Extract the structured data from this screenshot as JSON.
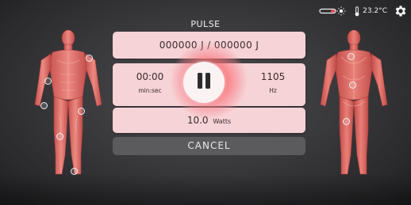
{
  "status_bar": {
    "laser_icon": "laser-probe-icon",
    "temperature": "23.2°C",
    "thermometer_icon": "thermometer-icon",
    "settings_icon": "gear-icon"
  },
  "mode_title": "PULSE",
  "energy": "000000 J / 000000 J",
  "timer": {
    "value": "00:00",
    "unit": "min:sec"
  },
  "frequency": {
    "value": "1105",
    "unit": "Hz"
  },
  "power": {
    "value": "10.0",
    "unit": "Watts"
  },
  "pause_icon": "pause-icon",
  "cancel_label": "CANCEL",
  "figures": {
    "front": "human-body-front-muscles",
    "back": "human-body-back-muscles"
  },
  "colors": {
    "panel": "#f6d3d6",
    "glow": "#f86e76",
    "cancel": "#5b5b5e",
    "background": "#3a3a3d"
  }
}
